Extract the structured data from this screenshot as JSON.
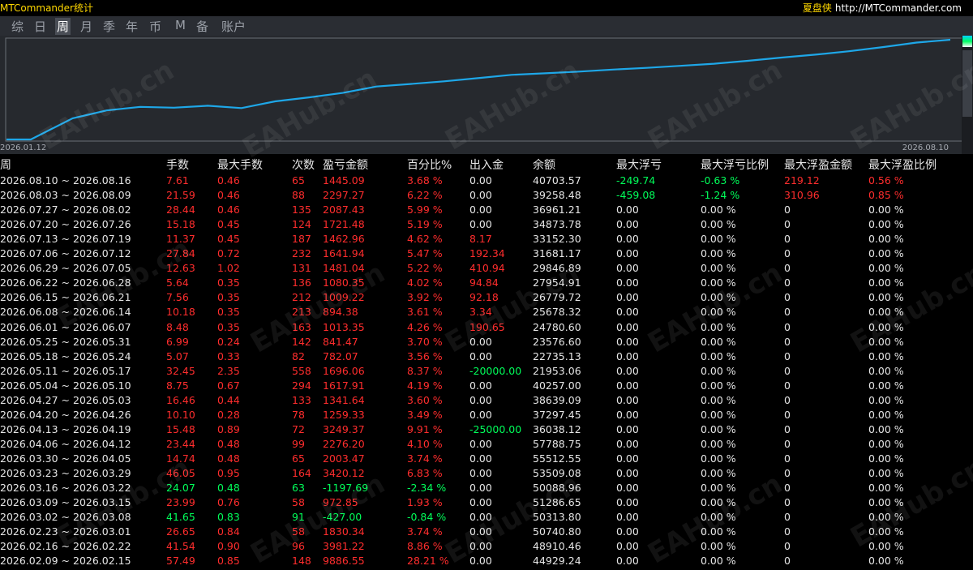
{
  "app": {
    "title": "MTCommander统计",
    "brand_name": "夏盘侠",
    "brand_url": "http://MTCommander.com"
  },
  "tabs": [
    "综",
    "日",
    "周",
    "月",
    "季",
    "年",
    "币",
    "M",
    "备",
    "账户"
  ],
  "active_tab": 2,
  "chart": {
    "start_date": "2026.01.12",
    "end_date": "2026.08.10",
    "line_color": "#1ea7e8"
  },
  "watermark": "EAHub.cn",
  "columns": [
    "周",
    "手数",
    "最大手数",
    "次数",
    "盈亏金额",
    "百分比%",
    "出入金",
    "余额",
    "最大浮亏",
    "最大浮亏比例",
    "最大浮盈金额",
    "最大浮盈比例"
  ],
  "rows": [
    [
      "2026.08.10 ~ 2026.08.16",
      "7.61",
      "0.46",
      "65",
      "1445.09",
      "3.68 %",
      "0.00",
      "40703.57",
      "-249.74",
      "-0.63 %",
      "219.12",
      "0.56 %"
    ],
    [
      "2026.08.03 ~ 2026.08.09",
      "21.59",
      "0.46",
      "88",
      "2297.27",
      "6.22 %",
      "0.00",
      "39258.48",
      "-459.08",
      "-1.24 %",
      "310.96",
      "0.85 %"
    ],
    [
      "2026.07.27 ~ 2026.08.02",
      "28.44",
      "0.46",
      "135",
      "2087.43",
      "5.99 %",
      "0.00",
      "36961.21",
      "0.00",
      "0.00 %",
      "0",
      "0.00 %"
    ],
    [
      "2026.07.20 ~ 2026.07.26",
      "15.18",
      "0.45",
      "124",
      "1721.48",
      "5.19 %",
      "0.00",
      "34873.78",
      "0.00",
      "0.00 %",
      "0",
      "0.00 %"
    ],
    [
      "2026.07.13 ~ 2026.07.19",
      "11.37",
      "0.45",
      "187",
      "1462.96",
      "4.62 %",
      "8.17",
      "33152.30",
      "0.00",
      "0.00 %",
      "0",
      "0.00 %"
    ],
    [
      "2026.07.06 ~ 2026.07.12",
      "27.84",
      "0.72",
      "232",
      "1641.94",
      "5.47 %",
      "192.34",
      "31681.17",
      "0.00",
      "0.00 %",
      "0",
      "0.00 %"
    ],
    [
      "2026.06.29 ~ 2026.07.05",
      "12.63",
      "1.02",
      "131",
      "1481.04",
      "5.22 %",
      "410.94",
      "29846.89",
      "0.00",
      "0.00 %",
      "0",
      "0.00 %"
    ],
    [
      "2026.06.22 ~ 2026.06.28",
      "5.64",
      "0.35",
      "136",
      "1080.35",
      "4.02 %",
      "94.84",
      "27954.91",
      "0.00",
      "0.00 %",
      "0",
      "0.00 %"
    ],
    [
      "2026.06.15 ~ 2026.06.21",
      "7.56",
      "0.35",
      "212",
      "1009.22",
      "3.92 %",
      "92.18",
      "26779.72",
      "0.00",
      "0.00 %",
      "0",
      "0.00 %"
    ],
    [
      "2026.06.08 ~ 2026.06.14",
      "10.18",
      "0.35",
      "213",
      "894.38",
      "3.61 %",
      "3.34",
      "25678.32",
      "0.00",
      "0.00 %",
      "0",
      "0.00 %"
    ],
    [
      "2026.06.01 ~ 2026.06.07",
      "8.48",
      "0.35",
      "163",
      "1013.35",
      "4.26 %",
      "190.65",
      "24780.60",
      "0.00",
      "0.00 %",
      "0",
      "0.00 %"
    ],
    [
      "2026.05.25 ~ 2026.05.31",
      "6.99",
      "0.24",
      "142",
      "841.47",
      "3.70 %",
      "0.00",
      "23576.60",
      "0.00",
      "0.00 %",
      "0",
      "0.00 %"
    ],
    [
      "2026.05.18 ~ 2026.05.24",
      "5.07",
      "0.33",
      "82",
      "782.07",
      "3.56 %",
      "0.00",
      "22735.13",
      "0.00",
      "0.00 %",
      "0",
      "0.00 %"
    ],
    [
      "2026.05.11 ~ 2026.05.17",
      "32.45",
      "2.35",
      "558",
      "1696.06",
      "8.37 %",
      "-20000.00",
      "21953.06",
      "0.00",
      "0.00 %",
      "0",
      "0.00 %"
    ],
    [
      "2026.05.04 ~ 2026.05.10",
      "8.75",
      "0.67",
      "294",
      "1617.91",
      "4.19 %",
      "0.00",
      "40257.00",
      "0.00",
      "0.00 %",
      "0",
      "0.00 %"
    ],
    [
      "2026.04.27 ~ 2026.05.03",
      "16.46",
      "0.44",
      "133",
      "1341.64",
      "3.60 %",
      "0.00",
      "38639.09",
      "0.00",
      "0.00 %",
      "0",
      "0.00 %"
    ],
    [
      "2026.04.20 ~ 2026.04.26",
      "10.10",
      "0.28",
      "78",
      "1259.33",
      "3.49 %",
      "0.00",
      "37297.45",
      "0.00",
      "0.00 %",
      "0",
      "0.00 %"
    ],
    [
      "2026.04.13 ~ 2026.04.19",
      "15.48",
      "0.89",
      "72",
      "3249.37",
      "9.91 %",
      "-25000.00",
      "36038.12",
      "0.00",
      "0.00 %",
      "0",
      "0.00 %"
    ],
    [
      "2026.04.06 ~ 2026.04.12",
      "23.44",
      "0.48",
      "99",
      "2276.20",
      "4.10 %",
      "0.00",
      "57788.75",
      "0.00",
      "0.00 %",
      "0",
      "0.00 %"
    ],
    [
      "2026.03.30 ~ 2026.04.05",
      "14.74",
      "0.48",
      "65",
      "2003.47",
      "3.74 %",
      "0.00",
      "55512.55",
      "0.00",
      "0.00 %",
      "0",
      "0.00 %"
    ],
    [
      "2026.03.23 ~ 2026.03.29",
      "46.05",
      "0.95",
      "164",
      "3420.12",
      "6.83 %",
      "0.00",
      "53509.08",
      "0.00",
      "0.00 %",
      "0",
      "0.00 %"
    ],
    [
      "2026.03.16 ~ 2026.03.22",
      "24.07",
      "0.48",
      "63",
      "-1197.69",
      "-2.34 %",
      "0.00",
      "50088.96",
      "0.00",
      "0.00 %",
      "0",
      "0.00 %"
    ],
    [
      "2026.03.09 ~ 2026.03.15",
      "23.99",
      "0.76",
      "58",
      "972.85",
      "1.93 %",
      "0.00",
      "51286.65",
      "0.00",
      "0.00 %",
      "0",
      "0.00 %"
    ],
    [
      "2026.03.02 ~ 2026.03.08",
      "41.65",
      "0.83",
      "91",
      "-427.00",
      "-0.84 %",
      "0.00",
      "50313.80",
      "0.00",
      "0.00 %",
      "0",
      "0.00 %"
    ],
    [
      "2026.02.23 ~ 2026.03.01",
      "26.65",
      "0.84",
      "58",
      "1830.34",
      "3.74 %",
      "0.00",
      "50740.80",
      "0.00",
      "0.00 %",
      "0",
      "0.00 %"
    ],
    [
      "2026.02.16 ~ 2026.02.22",
      "41.54",
      "0.90",
      "96",
      "3981.22",
      "8.86 %",
      "0.00",
      "48910.46",
      "0.00",
      "0.00 %",
      "0",
      "0.00 %"
    ],
    [
      "2026.02.09 ~ 2026.02.15",
      "57.49",
      "0.85",
      "148",
      "9886.55",
      "28.21 %",
      "0.00",
      "44929.24",
      "0.00",
      "0.00 %",
      "0",
      "0.00 %"
    ]
  ]
}
